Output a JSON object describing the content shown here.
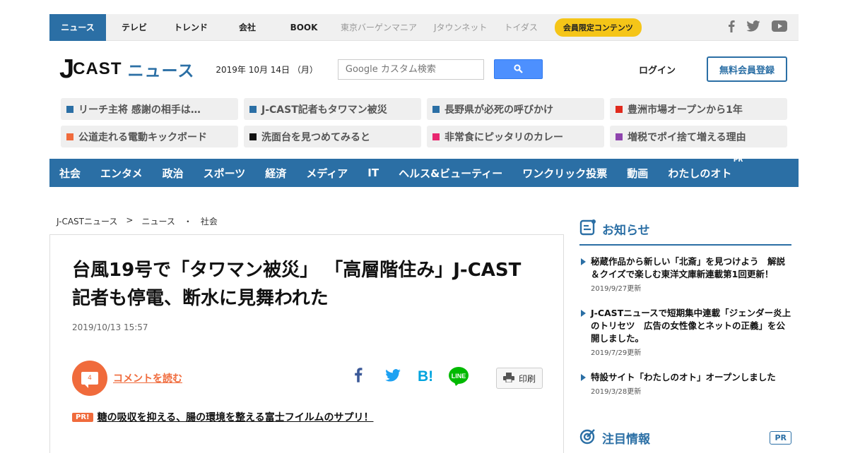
{
  "topnav": {
    "tabs": [
      {
        "label": "ニュース"
      },
      {
        "label": "テレビ"
      },
      {
        "label": "トレンド"
      },
      {
        "label": "会社"
      },
      {
        "label": "BOOK"
      }
    ],
    "external": [
      "東京バーゲンマニア",
      "Jタウンネット",
      "トイダス"
    ],
    "member_label": "会員限定コンテンツ"
  },
  "header": {
    "logo": {
      "j": "J",
      "cast": "CAST",
      "news": "ニュース"
    },
    "date": "2019年 10月 14日 （月）",
    "search_placeholder": "Google カスタム検索",
    "login_label": "ログイン",
    "register_label": "無料会員登録"
  },
  "trending": [
    {
      "label": "リーチ主将 感謝の相手は…",
      "color": "#2b6fa5"
    },
    {
      "label": "J-CAST記者もタワマン被災",
      "color": "#2b6fa5"
    },
    {
      "label": "長野県が必死の呼びかけ",
      "color": "#2b6fa5"
    },
    {
      "label": "豊洲市場オープンから1年",
      "color": "#e02a1d"
    },
    {
      "label": "公道走れる電動キックボード",
      "color": "#f06b3c"
    },
    {
      "label": "洗面台を見つめてみると",
      "color": "#111111"
    },
    {
      "label": "非常食にピッタリのカレー",
      "color": "#e8266f"
    },
    {
      "label": "増税でポイ捨て増える理由",
      "color": "#8e44ad"
    }
  ],
  "categories": [
    "社会",
    "エンタメ",
    "政治",
    "スポーツ",
    "経済",
    "メディア",
    "IT",
    "ヘルス&ビューティー",
    "ワンクリック投票",
    "動画",
    "わたしのオト"
  ],
  "category_pr": "PR",
  "breadcrumb": [
    "J-CASTニュース",
    ">",
    "ニュース",
    "・",
    "社会"
  ],
  "article": {
    "title": "台風19号で「タワマン被災」 「高層階住み」J-CAST記者も停電、断水に見舞われた",
    "date": "2019/10/13 15:57",
    "comment_count": "4",
    "comment_link": "コメントを読む",
    "print_label": "印刷",
    "pr_badge": "PR!",
    "pr_text": "糖の吸収を抑える、腸の環境を整える富士フイルムのサプリ！"
  },
  "sidebar": {
    "notice_title": "お知らせ",
    "notices": [
      {
        "text": "秘蔵作品から新しい「北斎」を見つけよう　解説＆クイズで楽しむ東洋文庫新連載第1回更新！",
        "date": "2019/9/27更新"
      },
      {
        "text": "J-CASTニュースで短期集中連載「ジェンダー炎上のトリセツ　広告の女性像とネットの正義」を公開しました。",
        "date": "2019/7/29更新"
      },
      {
        "text": "特設サイト「わたしのオト」オープンしました",
        "date": "2019/3/28更新"
      }
    ],
    "attention_title": "注目情報",
    "attention_pr": "PR"
  },
  "colors": {
    "brand": "#2b6fa5",
    "accent": "#f06b3c",
    "member": "#f5c518"
  }
}
